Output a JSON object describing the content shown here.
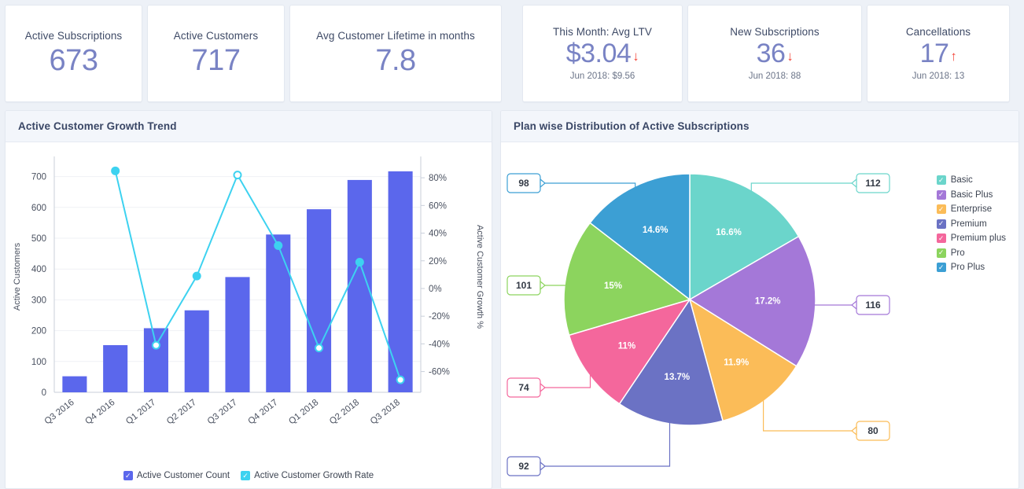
{
  "kpis": [
    {
      "title": "Active Subscriptions",
      "value": "673",
      "trend": "",
      "sub": ""
    },
    {
      "title": "Active Customers",
      "value": "717",
      "trend": "",
      "sub": ""
    },
    {
      "title": "Avg Customer Lifetime in months",
      "value": "7.8",
      "trend": "",
      "sub": ""
    },
    {
      "title": "This Month: Avg LTV",
      "value": "$3.04",
      "trend": "down",
      "trend_glyph": "↓",
      "sub": "Jun 2018: $9.56"
    },
    {
      "title": "New Subscriptions",
      "value": "36",
      "trend": "down",
      "trend_glyph": "↓",
      "sub": "Jun 2018: 88"
    },
    {
      "title": "Cancellations",
      "value": "17",
      "trend": "up",
      "trend_glyph": "↑",
      "sub": "Jun 2018: 13"
    }
  ],
  "panels": {
    "growth": {
      "title": "Active Customer Growth Trend"
    },
    "plan": {
      "title": "Plan wise Distribution of Active Subscriptions"
    }
  },
  "chart_data": [
    {
      "type": "bar",
      "title": "Active Customer Growth Trend",
      "categories": [
        "Q3 2016",
        "Q4 2016",
        "Q1 2017",
        "Q2 2017",
        "Q3 2017",
        "Q4 2017",
        "Q1 2018",
        "Q2 2018",
        "Q3 2018"
      ],
      "xlabel": "",
      "ylabel": "Active Customers",
      "y2label": "Active Customer Growth %",
      "ylim": [
        0,
        750
      ],
      "yticks": [
        0,
        100,
        200,
        300,
        400,
        500,
        600,
        700
      ],
      "y2lim": [
        -75,
        92
      ],
      "y2ticks": [
        -60,
        -40,
        -20,
        0,
        20,
        40,
        60,
        80
      ],
      "y2ticklabels": [
        "-60%",
        "-40%",
        "-20%",
        "0%",
        "20%",
        "40%",
        "60%",
        "80%"
      ],
      "grid": true,
      "legend_position": "bottom",
      "series": [
        {
          "name": "Active Customer Count",
          "type": "bar",
          "color": "#5B67EC",
          "values": [
            52,
            153,
            208,
            266,
            374,
            512,
            594,
            689,
            717
          ]
        },
        {
          "name": "Active Customer Growth Rate",
          "type": "line",
          "color": "#3DD2F0",
          "unit": "%",
          "values": [
            null,
            85,
            -41,
            9,
            82,
            31,
            -43,
            19,
            -66
          ]
        }
      ]
    },
    {
      "type": "pie",
      "title": "Plan wise Distribution of Active Subscriptions",
      "labels": [
        "Basic",
        "Basic Plus",
        "Enterprise",
        "Premium",
        "Premium plus",
        "Pro",
        "Pro Plus"
      ],
      "values": [
        112,
        116,
        80,
        92,
        74,
        101,
        98
      ],
      "percent_labels": [
        "16.6%",
        "17.2%",
        "11.9%",
        "13.7%",
        "11%",
        "15%",
        "14.6%"
      ],
      "colors": [
        "#6BD5CB",
        "#A478D8",
        "#FBBC58",
        "#6B72C4",
        "#F4679C",
        "#8CD45E",
        "#3C9FD4"
      ],
      "legend_position": "right",
      "total": 673
    }
  ]
}
